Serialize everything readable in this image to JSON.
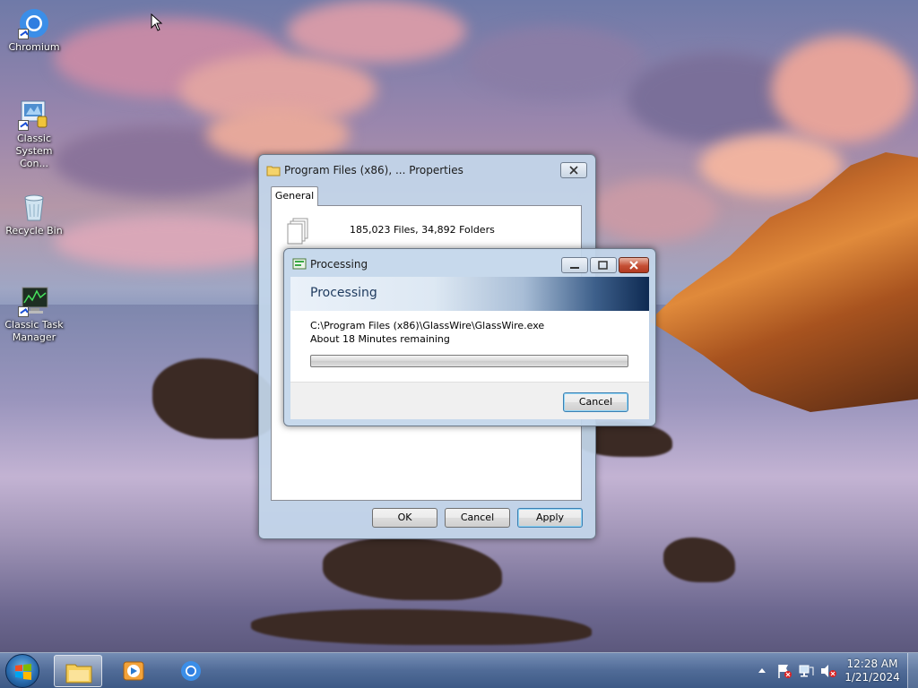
{
  "desktop": {
    "icons": [
      {
        "label": "Chromium"
      },
      {
        "label": "Classic System Con..."
      },
      {
        "label": "Recycle Bin"
      },
      {
        "label": "Classic Task Manager"
      }
    ]
  },
  "properties_window": {
    "title": "Program Files (x86), ... Properties",
    "tab_general": "General",
    "summary": "185,023 Files, 34,892 Folders",
    "ok_label": "OK",
    "cancel_label": "Cancel",
    "apply_label": "Apply"
  },
  "processing_dialog": {
    "title": "Processing",
    "header": "Processing",
    "current_file": "C:\\Program Files (x86)\\GlassWire\\GlassWire.exe",
    "remaining": "About 18 Minutes remaining",
    "progress_fraction": 0.0,
    "cancel_label": "Cancel"
  },
  "taskbar": {
    "time": "12:28 AM",
    "date": "1/21/2024"
  }
}
